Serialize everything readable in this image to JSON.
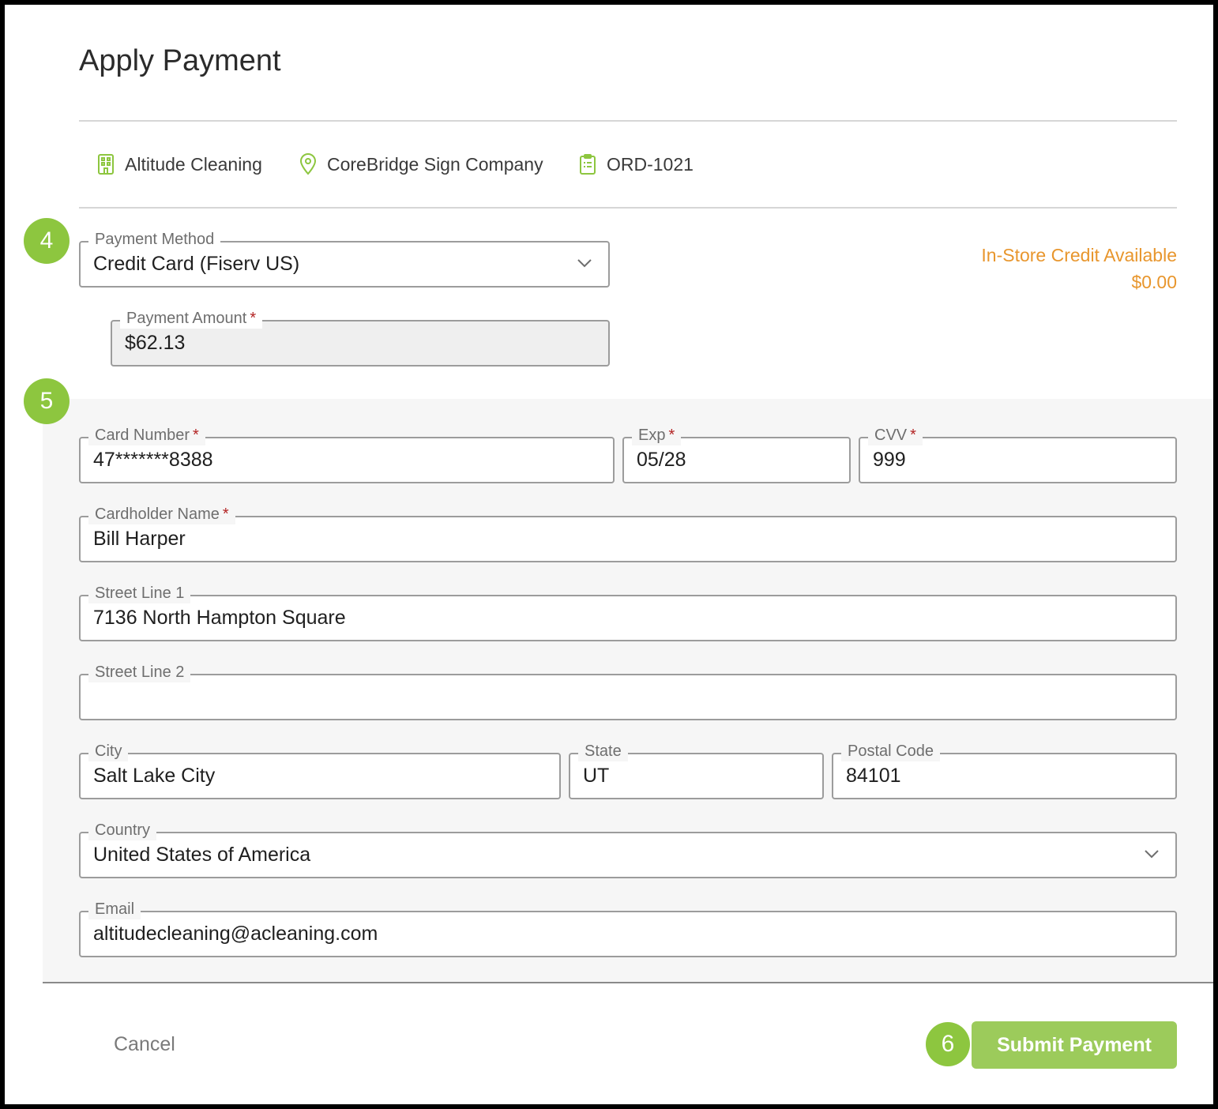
{
  "dialog": {
    "title": "Apply Payment"
  },
  "context": {
    "company": "Altitude Cleaning",
    "location": "CoreBridge Sign Company",
    "order": "ORD-1021"
  },
  "steps": {
    "payment_method": "4",
    "card_details": "5",
    "submit": "6"
  },
  "payment": {
    "method_label": "Payment Method",
    "method_value": "Credit Card (Fiserv US)",
    "amount_label": "Payment Amount",
    "amount_value": "$62.13",
    "credit_label": "In-Store Credit Available",
    "credit_value": "$0.00"
  },
  "card": {
    "number_label": "Card Number",
    "number_value": "47*******8388",
    "exp_label": "Exp",
    "exp_value": "05/28",
    "cvv_label": "CVV",
    "cvv_value": "999",
    "name_label": "Cardholder Name",
    "name_value": "Bill Harper",
    "street1_label": "Street Line 1",
    "street1_value": "7136 North Hampton Square",
    "street2_label": "Street Line 2",
    "street2_value": "",
    "city_label": "City",
    "city_value": "Salt Lake City",
    "state_label": "State",
    "state_value": "UT",
    "postal_label": "Postal Code",
    "postal_value": "84101",
    "country_label": "Country",
    "country_value": "United States of America",
    "email_label": "Email",
    "email_value": "altitudecleaning@acleaning.com"
  },
  "required_marker": "*",
  "actions": {
    "cancel": "Cancel",
    "submit": "Submit Payment"
  },
  "colors": {
    "accent": "#8dc63f",
    "button": "#9ccb5b",
    "credit": "#e8962d",
    "required": "#b32424"
  },
  "icons": [
    "building-icon",
    "location-pin-icon",
    "clipboard-icon",
    "chevron-down-icon"
  ]
}
